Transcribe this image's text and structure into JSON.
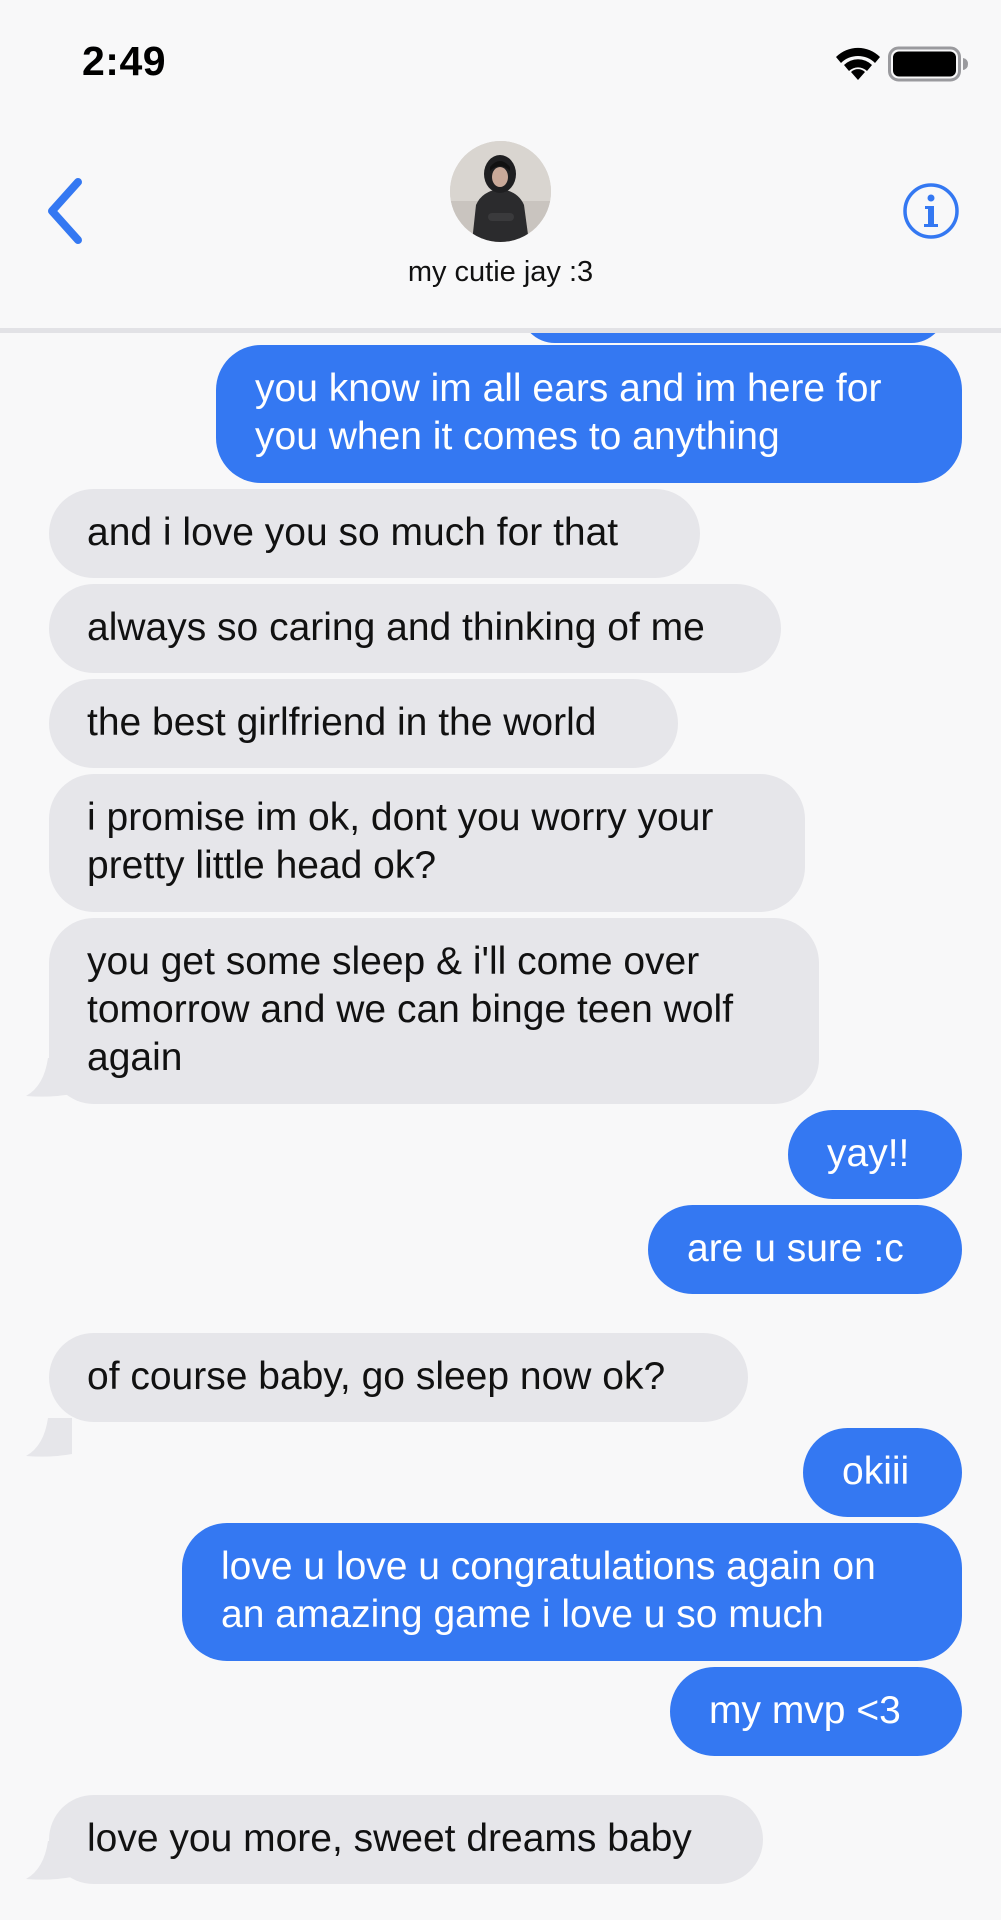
{
  "status_bar": {
    "time": "2:49",
    "wifi_icon": "wifi-icon",
    "battery_icon": "battery-icon"
  },
  "header": {
    "back_icon": "chevron-left-icon",
    "contact_name": "my cutie jay :3",
    "info_icon": "info-icon"
  },
  "colors": {
    "sent_bubble": "#3478f2",
    "received_bubble": "#e6e6ea",
    "accent": "#3478f2",
    "background": "#f8f8f9"
  },
  "messages": [
    {
      "direction": "sent",
      "lines": [
        "you know im all ears and im here for",
        "you when it comes to anything"
      ]
    },
    {
      "direction": "received",
      "lines": [
        "and i love you so much for that"
      ]
    },
    {
      "direction": "received",
      "lines": [
        "always so caring and thinking of me"
      ]
    },
    {
      "direction": "received",
      "lines": [
        "the best girlfriend in the world"
      ]
    },
    {
      "direction": "received",
      "lines": [
        "i promise im ok, dont you worry your",
        "pretty little head ok?"
      ]
    },
    {
      "direction": "received",
      "lines": [
        "you get some sleep & i'll come over",
        "tomorrow and we can binge teen wolf",
        "again"
      ]
    },
    {
      "direction": "sent",
      "lines": [
        "yay!!"
      ]
    },
    {
      "direction": "sent",
      "lines": [
        "are u sure :c"
      ]
    },
    {
      "direction": "received",
      "lines": [
        "of course baby, go sleep now ok?"
      ]
    },
    {
      "direction": "sent",
      "lines": [
        "okiii"
      ]
    },
    {
      "direction": "sent",
      "lines": [
        "love u love u congratulations again on",
        "an amazing game i love u so much"
      ]
    },
    {
      "direction": "sent",
      "lines": [
        "my mvp <3"
      ]
    },
    {
      "direction": "received",
      "lines": [
        "love you more, sweet dreams baby"
      ]
    }
  ]
}
